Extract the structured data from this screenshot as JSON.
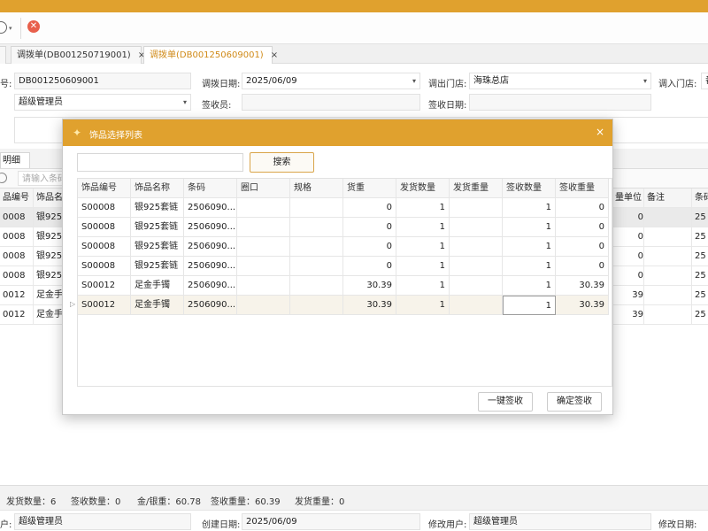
{
  "colors": {
    "accent": "#e0a12e",
    "close": "#e8604c"
  },
  "toolbar": {
    "settings_icon": "gear-icon",
    "close_icon": "close-circle-icon"
  },
  "tabs": [
    {
      "label": "调拨单(DB001250719001)",
      "close": "×"
    },
    {
      "label": "调拨单(DB001250609001)",
      "close": "×"
    }
  ],
  "form": {
    "no_label": "号:",
    "no_value": "DB001250609001",
    "date_label": "调拨日期:",
    "date_value": "2025/06/09",
    "out_store_label": "调出门店:",
    "out_store_value": "海珠总店",
    "in_store_label": "调入门店:",
    "in_store_value": "番",
    "user_value": "超级管理员",
    "receiver_label": "签收员:",
    "receiver_value": "",
    "receive_date_label": "签收日期:",
    "receive_date_value": ""
  },
  "bg": {
    "tab_label": "明细",
    "search_placeholder": "请输入条码",
    "headers": [
      "品编号",
      "饰品名",
      "量单位",
      "备注",
      "条码"
    ],
    "rows": [
      [
        "0008",
        "银925",
        "0",
        "",
        "25"
      ],
      [
        "0008",
        "银925",
        "0",
        "",
        "25"
      ],
      [
        "0008",
        "银925",
        "0",
        "",
        "25"
      ],
      [
        "0008",
        "银925",
        "0",
        "",
        "25"
      ],
      [
        "0012",
        "足金手",
        "39",
        "",
        "25"
      ],
      [
        "0012",
        "足金手",
        "39",
        "",
        "25"
      ]
    ]
  },
  "status": {
    "send_qty": "发货数量：6",
    "recv_qty": "签收数量：0",
    "weight": "金/银重：60.78",
    "recv_weight": "签收重量：60.39",
    "send_weight": "发货重量：0"
  },
  "footer": {
    "user_label": "户:",
    "user_value": "超级管理员",
    "create_label": "创建日期:",
    "create_value": "2025/06/09",
    "modify_user_label": "修改用户:",
    "modify_user_value": "超级管理员",
    "modify_date_label": "修改日期:"
  },
  "modal": {
    "title": "饰品选择列表",
    "close": "×",
    "search_value": "",
    "search_button": "搜索",
    "headers": [
      "饰品编号",
      "饰品名称",
      "条码",
      "圈口",
      "规格",
      "货重",
      "发货数量",
      "发货重量",
      "签收数量",
      "签收重量"
    ],
    "rows": [
      [
        "S00008",
        "银925套链",
        "2506090...",
        "",
        "",
        "0",
        "1",
        "",
        "1",
        "0"
      ],
      [
        "S00008",
        "银925套链",
        "2506090...",
        "",
        "",
        "0",
        "1",
        "",
        "1",
        "0"
      ],
      [
        "S00008",
        "银925套链",
        "2506090...",
        "",
        "",
        "0",
        "1",
        "",
        "1",
        "0"
      ],
      [
        "S00008",
        "银925套链",
        "2506090...",
        "",
        "",
        "0",
        "1",
        "",
        "1",
        "0"
      ],
      [
        "S00012",
        "足金手镯",
        "2506090...",
        "",
        "",
        "30.39",
        "1",
        "",
        "1",
        "30.39"
      ],
      [
        "S00012",
        "足金手镯",
        "2506090...",
        "",
        "",
        "30.39",
        "1",
        "",
        "1",
        "30.39"
      ]
    ],
    "row_marker": "▷",
    "btn_one_key": "一键签收",
    "btn_confirm": "确定签收"
  }
}
